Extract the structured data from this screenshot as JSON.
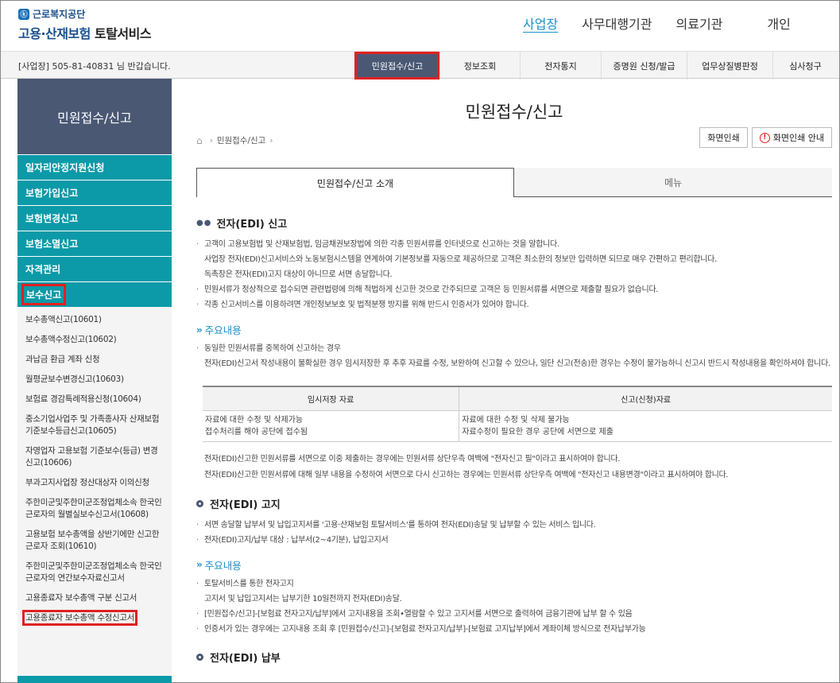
{
  "header": {
    "org_name": "근로복지공단",
    "service_name_blue": "고용·산재보험",
    "service_name_dark": "토탈서비스",
    "top_nav": [
      "사업장",
      "사무대행기관",
      "의료기관",
      "개인"
    ]
  },
  "gnb": {
    "welcome": "[사업장] 505-81-40831 님 반갑습니다.",
    "menu": [
      "민원접수/신고",
      "정보조회",
      "전자통지",
      "증명원 신청/발급",
      "업무상질병판정",
      "심사청구"
    ]
  },
  "sidebar": {
    "title": "민원접수/신고",
    "categories": [
      "일자리안정지원신청",
      "보험가입신고",
      "보험변경신고",
      "보험소멸신고",
      "자격관리",
      "보수신고"
    ],
    "sub_items": [
      "보수총액신고(10601)",
      "보수총액수정신고(10602)",
      "과납금 환급 계좌 신청",
      "월평균보수변경신고(10603)",
      "보험료 경감특례적용신청(10604)",
      "중소기업사업주 및 가족종사자 산재보험 기준보수등급신고(10605)",
      "자영업자 고용보험 기준보수(등급) 변경신고(10606)",
      "부과고지사업장 정산대상자 이의신청",
      "주한미군및주한미군조정업체소속 한국인근로자의 월별실보수신고서(10608)",
      "고용보험 보수총액을 상반기에만 신고한 근로자 조회(10610)",
      "주한미군및주한미군조정업체소속 한국인근로자의 연간보수자료신고서",
      "고용종료자 보수총액 구분 신고서",
      "고용종료자 보수총액 수정신고서"
    ]
  },
  "main": {
    "title": "민원접수/신고",
    "breadcrumb": "민원접수/신고",
    "print_button": "화면인쇄",
    "print_guide_button": "화면인쇄 안내",
    "tabs": [
      "민원접수/신고 소개",
      "메뉴"
    ],
    "section1": {
      "title": "전자(EDI) 신고",
      "bullets": [
        "고객이 고용보험법 및 산재보험법, 임금채권보장법에 의한 각종 민원서류를 인터넷으로 신고하는 것을 말합니다.",
        "사업장 전자(EDI)신고서비스와 노동보험시스템을 연계하여 기본정보를 자동으로 제공하므로 고객은 최소한의 정보만 입력하면 되므로 매우 간편하고 편리합니다.",
        "독촉장은 전자(EDI)고지 대상이 아니므로 서면 송달합니다.",
        "민원서류가 정상적으로 접수되면 관련법령에 의해 적법하게 신고한 것으로 간주되므로 고객은 등 민원서류를 서면으로 제출할 필요가 없습니다.",
        "각종 신고서비스를 이용하려면 개인정보보호 및 법적분쟁 방지를 위해 반드시 인증서가 있어야 합니다."
      ],
      "sub_title": "주요내용",
      "sub_bullets": [
        "동일한 민원서류를 중복하여 신고하는 경우",
        "전자(EDI)신고서 작성내용이 불확실한 경우 임시저장한 후 추후 자료를 수정, 보완하여 신고할 수 있으나, 일단 신고(전송)한 경우는 수정이 불가능하니 신고시 반드시 작성내용을 확인하셔야 합니다."
      ],
      "table": {
        "headers": [
          "임시저장 자료",
          "신고(신청)자료"
        ],
        "col1": [
          "자료에 대한 수정 및 삭제가능",
          "접수처리를 해야 공단에 접수됨"
        ],
        "col2": [
          "자료에 대한 수정 및 삭제 불가능",
          "자료수정이 필요한 경우 공단에 서면으로 제출"
        ]
      },
      "notes": [
        "전자(EDI)신고한 민원서류를 서면으로 이중 제출하는 경우에는 민원서류 상단우측 여백에 \"전자신고 필\"이라고 표시하여야 합니다.",
        "전자(EDI)신고한 민원서류에 대해 일부 내용을 수정하여 서면으로 다시 신고하는 경우에는 민원서류 상단우측 여백에 \"전자신고 내용변경\"이라고 표시하여야 합니다."
      ]
    },
    "section2": {
      "title": "전자(EDI) 고지",
      "bullets": [
        "서면 송달할 납부서 및 납입고지서를 '고용·산재보험 토탈서비스'를 통하여 전자(EDI)송달 및 납부할 수 있는 서비스 입니다.",
        "전자(EDI)고지/납부 대상 : 납부서(2~4기분), 납입고지서"
      ],
      "sub_title": "주요내용",
      "sub_bullets": [
        "토탈서비스를 통한 전자고지",
        "고지서 및 납입고지서는 납부기한 10일전까지 전자(EDI)송달.",
        "[민원접수/신고]-[보험료 전자고지/납부]에서 고지내용을 조회•열람할 수 있고 고지서를 서면으로 출력하여 금융기관에 납부 할 수 있음",
        "인증서가 있는 경우에는 고지내용 조회 후 [민원접수/신고]-[보험료 전자고지/납부]-[보험료 고지납부]에서 계좌이체 방식으로 전자납부가능"
      ]
    },
    "section3": {
      "title": "전자(EDI) 납부"
    }
  }
}
